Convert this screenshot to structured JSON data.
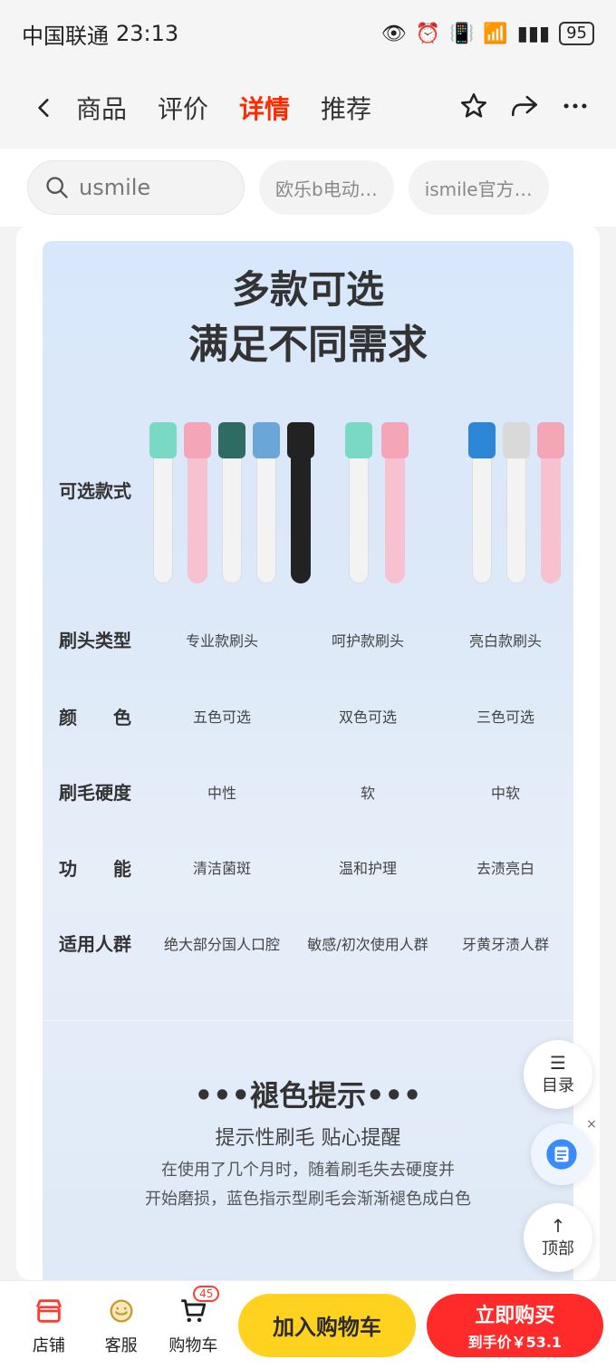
{
  "status": {
    "carrier": "中国联通",
    "time": "23:13",
    "battery": "95"
  },
  "nav": {
    "tabs": [
      "商品",
      "评价",
      "详情",
      "推荐"
    ],
    "active_tab_index": 2
  },
  "search": {
    "query": "usmile",
    "chips": [
      "欧乐b电动…",
      "ismile官方…"
    ]
  },
  "poster": {
    "title_line1": "多款可选",
    "title_line2": "满足不同需求",
    "row_labels": [
      "可选款式",
      "刷头类型",
      "颜　　色",
      "刷毛硬度",
      "功　　能",
      "适用人群"
    ],
    "columns": [
      {
        "type": "专业款刷头",
        "color": "五色可选",
        "hardness": "中性",
        "function": "清洁菌斑",
        "people": "绝大部分国人口腔"
      },
      {
        "type": "呵护款刷头",
        "color": "双色可选",
        "hardness": "软",
        "function": "温和护理",
        "people": "敏感/初次使用人群"
      },
      {
        "type": "亮白款刷头",
        "color": "三色可选",
        "hardness": "中软",
        "function": "去渍亮白",
        "people": "牙黄牙渍人群"
      }
    ],
    "section2_title": "•••褪色提示•••",
    "section2_sub": "提示性刷毛 贴心提醒",
    "section2_desc_line1": "在使用了几个月时，随着刷毛失去硬度并",
    "section2_desc_line2": "开始磨损，蓝色指示型刷毛会渐渐褪色成白色"
  },
  "floating": {
    "catalog": "目录",
    "top": "顶部"
  },
  "bottom": {
    "store": "店铺",
    "service": "客服",
    "cart": "购物车",
    "cart_count": "45",
    "add_to_cart": "加入购物车",
    "buy_now": "立即购买",
    "price_label": "到手价￥53.1"
  }
}
